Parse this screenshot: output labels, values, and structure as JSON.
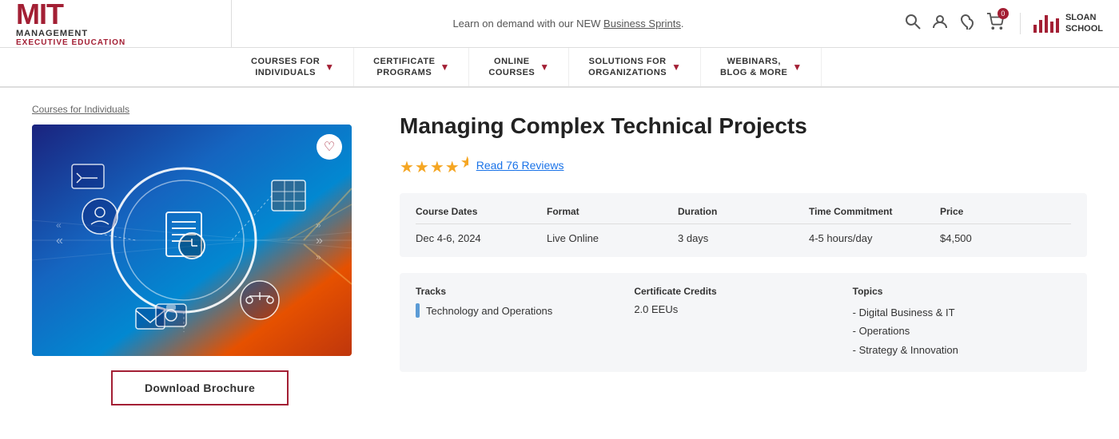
{
  "banner": {
    "announcement": "Learn on demand with our NEW ",
    "announcement_link": "Business Sprints",
    "announcement_suffix": "."
  },
  "logo": {
    "mit": "MIT",
    "management": "MANAGEMENT",
    "executive": "EXECUTIVE EDUCATION"
  },
  "sloan": {
    "school": "SLOAN",
    "school2": "SCHOOL"
  },
  "nav": {
    "items": [
      {
        "label": "COURSES FOR\nINDIVIDUALS"
      },
      {
        "label": "CERTIFICATE\nPROGRAMS"
      },
      {
        "label": "ONLINE\nCOURSES"
      },
      {
        "label": "SOLUTIONS FOR\nORGANIZATIONS"
      },
      {
        "label": "WEBINARS,\nBLOG & MORE"
      }
    ]
  },
  "breadcrumb": "Courses for Individuals",
  "course": {
    "title": "Managing Complex Technical Projects",
    "stars": "★★★★½",
    "reviews_text": "Read 76 Reviews",
    "heart_icon": "♡",
    "table": {
      "headers": [
        "Course Dates",
        "Format",
        "Duration",
        "Time Commitment",
        "Price"
      ],
      "row": [
        "Dec 4-6, 2024",
        "Live Online",
        "3 days",
        "4-5 hours/day",
        "$4,500"
      ]
    },
    "tracks_label": "Tracks",
    "track_value": "Technology and Operations",
    "credits_label": "Certificate Credits",
    "credits_value": "2.0 EEUs",
    "topics_label": "Topics",
    "topics": [
      "- Digital Business & IT",
      "- Operations",
      "- Strategy & Innovation"
    ],
    "download_btn": "Download Brochure"
  }
}
